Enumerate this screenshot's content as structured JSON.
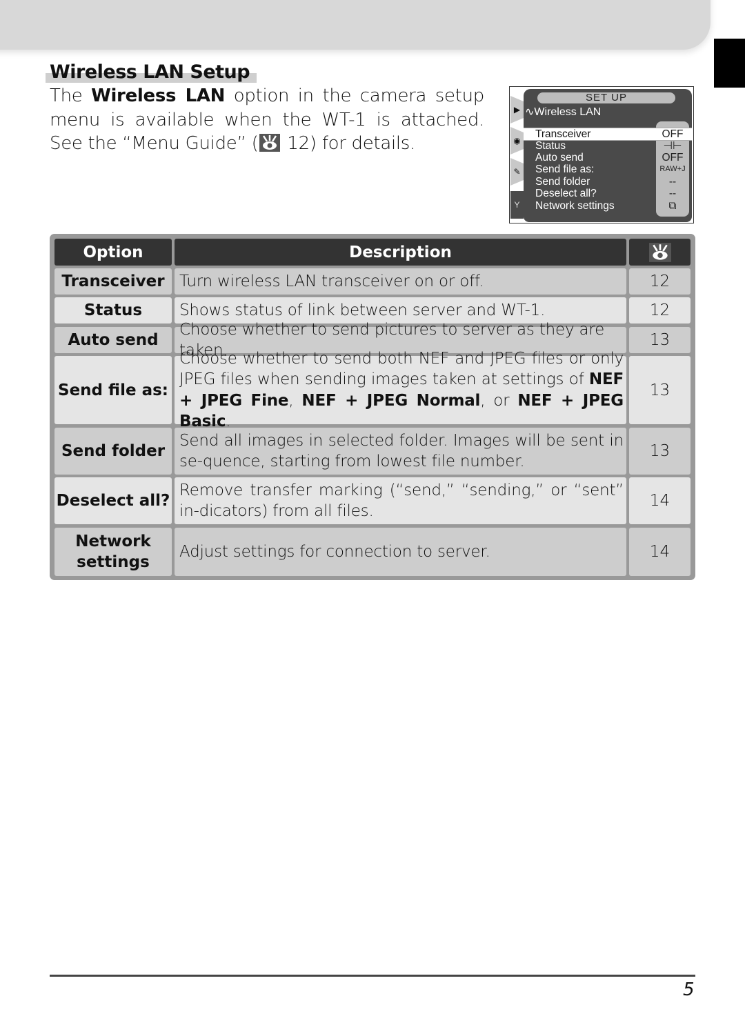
{
  "section": {
    "title": "Wireless LAN Setup",
    "intro_pre": "The ",
    "intro_bold": "Wireless LAN",
    "intro_mid": " option in the camera setup menu is available when the WT-1 is attached.  See the “Menu Guide” (",
    "intro_ref_icon": "reference-eye-icon",
    "intro_ref_page": " 12",
    "intro_post": ") for details."
  },
  "camera_menu": {
    "header": "SET UP",
    "subtitle": "Wireless LAN",
    "tabs": [
      {
        "icon": "playback-icon",
        "glyph": "▶"
      },
      {
        "icon": "camera-icon",
        "glyph": "◘"
      },
      {
        "icon": "pencil-icon",
        "glyph": "✎"
      },
      {
        "icon": "wrench-icon",
        "glyph": "Ϋ"
      }
    ],
    "items": [
      {
        "label": "Transceiver",
        "value": "OFF",
        "selected": true
      },
      {
        "label": "Status",
        "value": "⊣⊢"
      },
      {
        "label": "Auto send",
        "value": "OFF"
      },
      {
        "label": "Send file as:",
        "value": "RAW+J"
      },
      {
        "label": "Send folder",
        "value": "--"
      },
      {
        "label": "Deselect all?",
        "value": "--"
      },
      {
        "label": "Network settings",
        "value": "⧉"
      }
    ]
  },
  "table": {
    "headers": {
      "option": "Option",
      "description": "Description",
      "page_icon": "reference-eye-icon"
    },
    "rows": [
      {
        "option": "Transceiver",
        "description": "Turn wireless LAN transceiver on or off.",
        "page": "12"
      },
      {
        "option": "Status",
        "description": "Shows status of link between server and WT-1.",
        "page": "12"
      },
      {
        "option": "Auto send",
        "description": "Choose whether to send pictures to server as they are taken.",
        "page": "13"
      },
      {
        "option": "Send file as:",
        "description_parts": [
          "Choose whether to send both NEF and JPEG files or only JPEG files when sending images taken at settings of ",
          "NEF + JPEG Fine",
          ", ",
          "NEF + JPEG Normal",
          ", or ",
          "NEF + JPEG Basic",
          "."
        ],
        "page": "13"
      },
      {
        "option": "Send folder",
        "description": "Send all images in selected folder.  Images will be sent in se-quence, starting from lowest file number.",
        "page": "13"
      },
      {
        "option": "Deselect all?",
        "description": "Remove transfer marking (“send,” “sending,” or “sent” in-dicators) from all files.",
        "page": "14"
      },
      {
        "option": "Network settings",
        "description": "Adjust settings for connection to server.",
        "page": "14"
      }
    ]
  },
  "footer": {
    "page_number": "5"
  }
}
